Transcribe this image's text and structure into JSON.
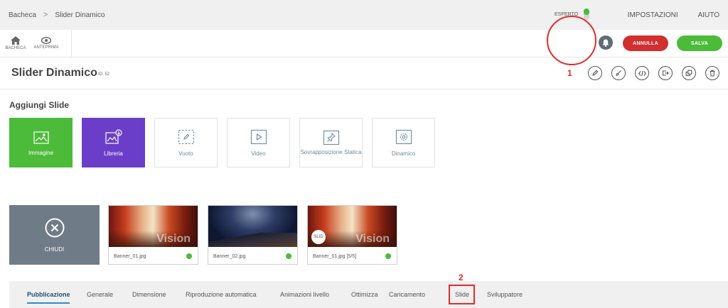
{
  "breadcrumb": {
    "home": "Bacheca",
    "separator": ">",
    "current": "Slider Dinamico"
  },
  "topnav": {
    "settings": "IMPOSTAZIONI",
    "help": "AIUTO"
  },
  "toolbar": {
    "dashboard": "BACHECA",
    "preview": "ANTEPRIMA"
  },
  "expert": {
    "label": "ESPERTO",
    "enabled": true
  },
  "actions": {
    "cancel": "ANNULLA",
    "save": "SALVA"
  },
  "annotations": {
    "first": "1",
    "second": "2"
  },
  "page": {
    "title": "Slider Dinamico",
    "id": "ID: 52"
  },
  "add_slide": {
    "title": "Aggiungi Slide",
    "cards": [
      {
        "label": "Immagine",
        "icon": "image-upload-icon"
      },
      {
        "label": "Libreria",
        "icon": "library-icon"
      },
      {
        "label": "Vuoto",
        "icon": "blank-slide-icon"
      },
      {
        "label": "Video",
        "icon": "video-icon"
      },
      {
        "label": "Sovrapposizione Statica",
        "icon": "pin-icon"
      },
      {
        "label": "Dinamico",
        "icon": "gear-icon"
      }
    ]
  },
  "slides": {
    "close_label": "CHIUDI",
    "items": [
      {
        "name": "Banner_01.jpg",
        "brand": "Vision"
      },
      {
        "name": "Banner_02.jpg"
      },
      {
        "name": "Banner_01.jpg [5/5]",
        "badge": "SLID",
        "brand": "Vision"
      }
    ]
  },
  "tabs": [
    "Pubblicazione",
    "Generale",
    "Dimensione",
    "Riproduzione automatica",
    "Animazioni livello",
    "Ottimizza",
    "Caricamento",
    "Slide",
    "Sviluppatore"
  ],
  "colors": {
    "green": "#4cbb3a",
    "red": "#d22f2f",
    "purple": "#6b3ec9",
    "annotation": "#e32b2b",
    "tab_active": "#1d4f76"
  }
}
